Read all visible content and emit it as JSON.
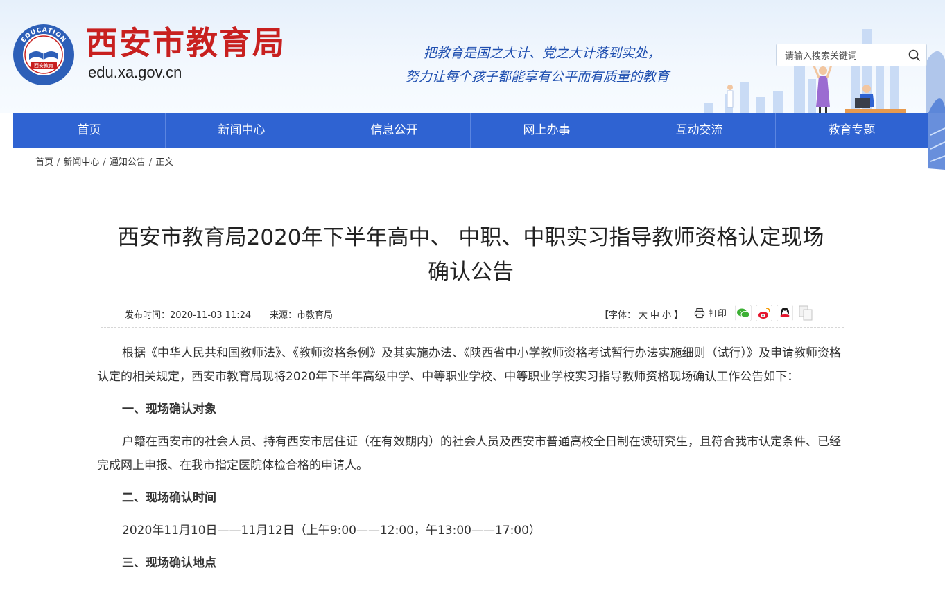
{
  "header": {
    "title": "西安市教育局",
    "domain": "edu.xa.gov.cn",
    "emblem_top": "EDUCATION",
    "emblem_bottom": "西安教育",
    "slogan_line1": "把教育是国之大计、党之大计落到实处，",
    "slogan_line2": "努力让每个孩子都能享有公平而有质量的教育"
  },
  "search": {
    "placeholder": "请输入搜索关键词"
  },
  "nav": {
    "items": [
      {
        "label": "首页"
      },
      {
        "label": "新闻中心"
      },
      {
        "label": "信息公开"
      },
      {
        "label": "网上办事"
      },
      {
        "label": "互动交流"
      },
      {
        "label": "教育专题"
      }
    ]
  },
  "breadcrumb": {
    "items": [
      {
        "label": "首页"
      },
      {
        "label": "新闻中心"
      },
      {
        "label": "通知公告"
      },
      {
        "label": "正文"
      }
    ],
    "separator": "/"
  },
  "article": {
    "title_line1": "西安市教育局2020年下半年高中、 中职、中职实习指导教师资格认定现场",
    "title_line2": "确认公告",
    "publish_time": "发布时间：2020-11-03 11:24",
    "source": "来源：市教育局",
    "font_label_open": "【字体：",
    "font_large": "大",
    "font_medium": "中",
    "font_small": "小",
    "font_label_close": "】",
    "print_label": "打印",
    "intro": "根据《中华人民共和国教师法》、《教师资格条例》及其实施办法、《陕西省中小学教师资格考试暂行办法实施细则（试行）》及申请教师资格认定的相关规定，西安市教育局现将2020年下半年高级中学、中等职业学校、中等职业学校实习指导教师资格现场确认工作公告如下：",
    "section1_heading": "一、现场确认对象",
    "section1_text": "户籍在西安市的社会人员、持有西安市居住证（在有效期内）的社会人员及西安市普通高校全日制在读研究生，且符合我市认定条件、已经完成网上申报、在我市指定医院体检合格的申请人。",
    "section2_heading": "二、现场确认时间",
    "section2_text": "2020年11月10日——11月12日（上午9:00——12:00，午13:00——17:00）",
    "section3_heading": "三、现场确认地点"
  },
  "colors": {
    "brand_red": "#c8201f",
    "nav_blue": "#2f63d2",
    "slogan_blue": "#1f4fb0"
  },
  "icons": [
    "print-icon",
    "wechat-icon",
    "weibo-icon",
    "qq-icon",
    "copy-icon",
    "search-icon"
  ]
}
